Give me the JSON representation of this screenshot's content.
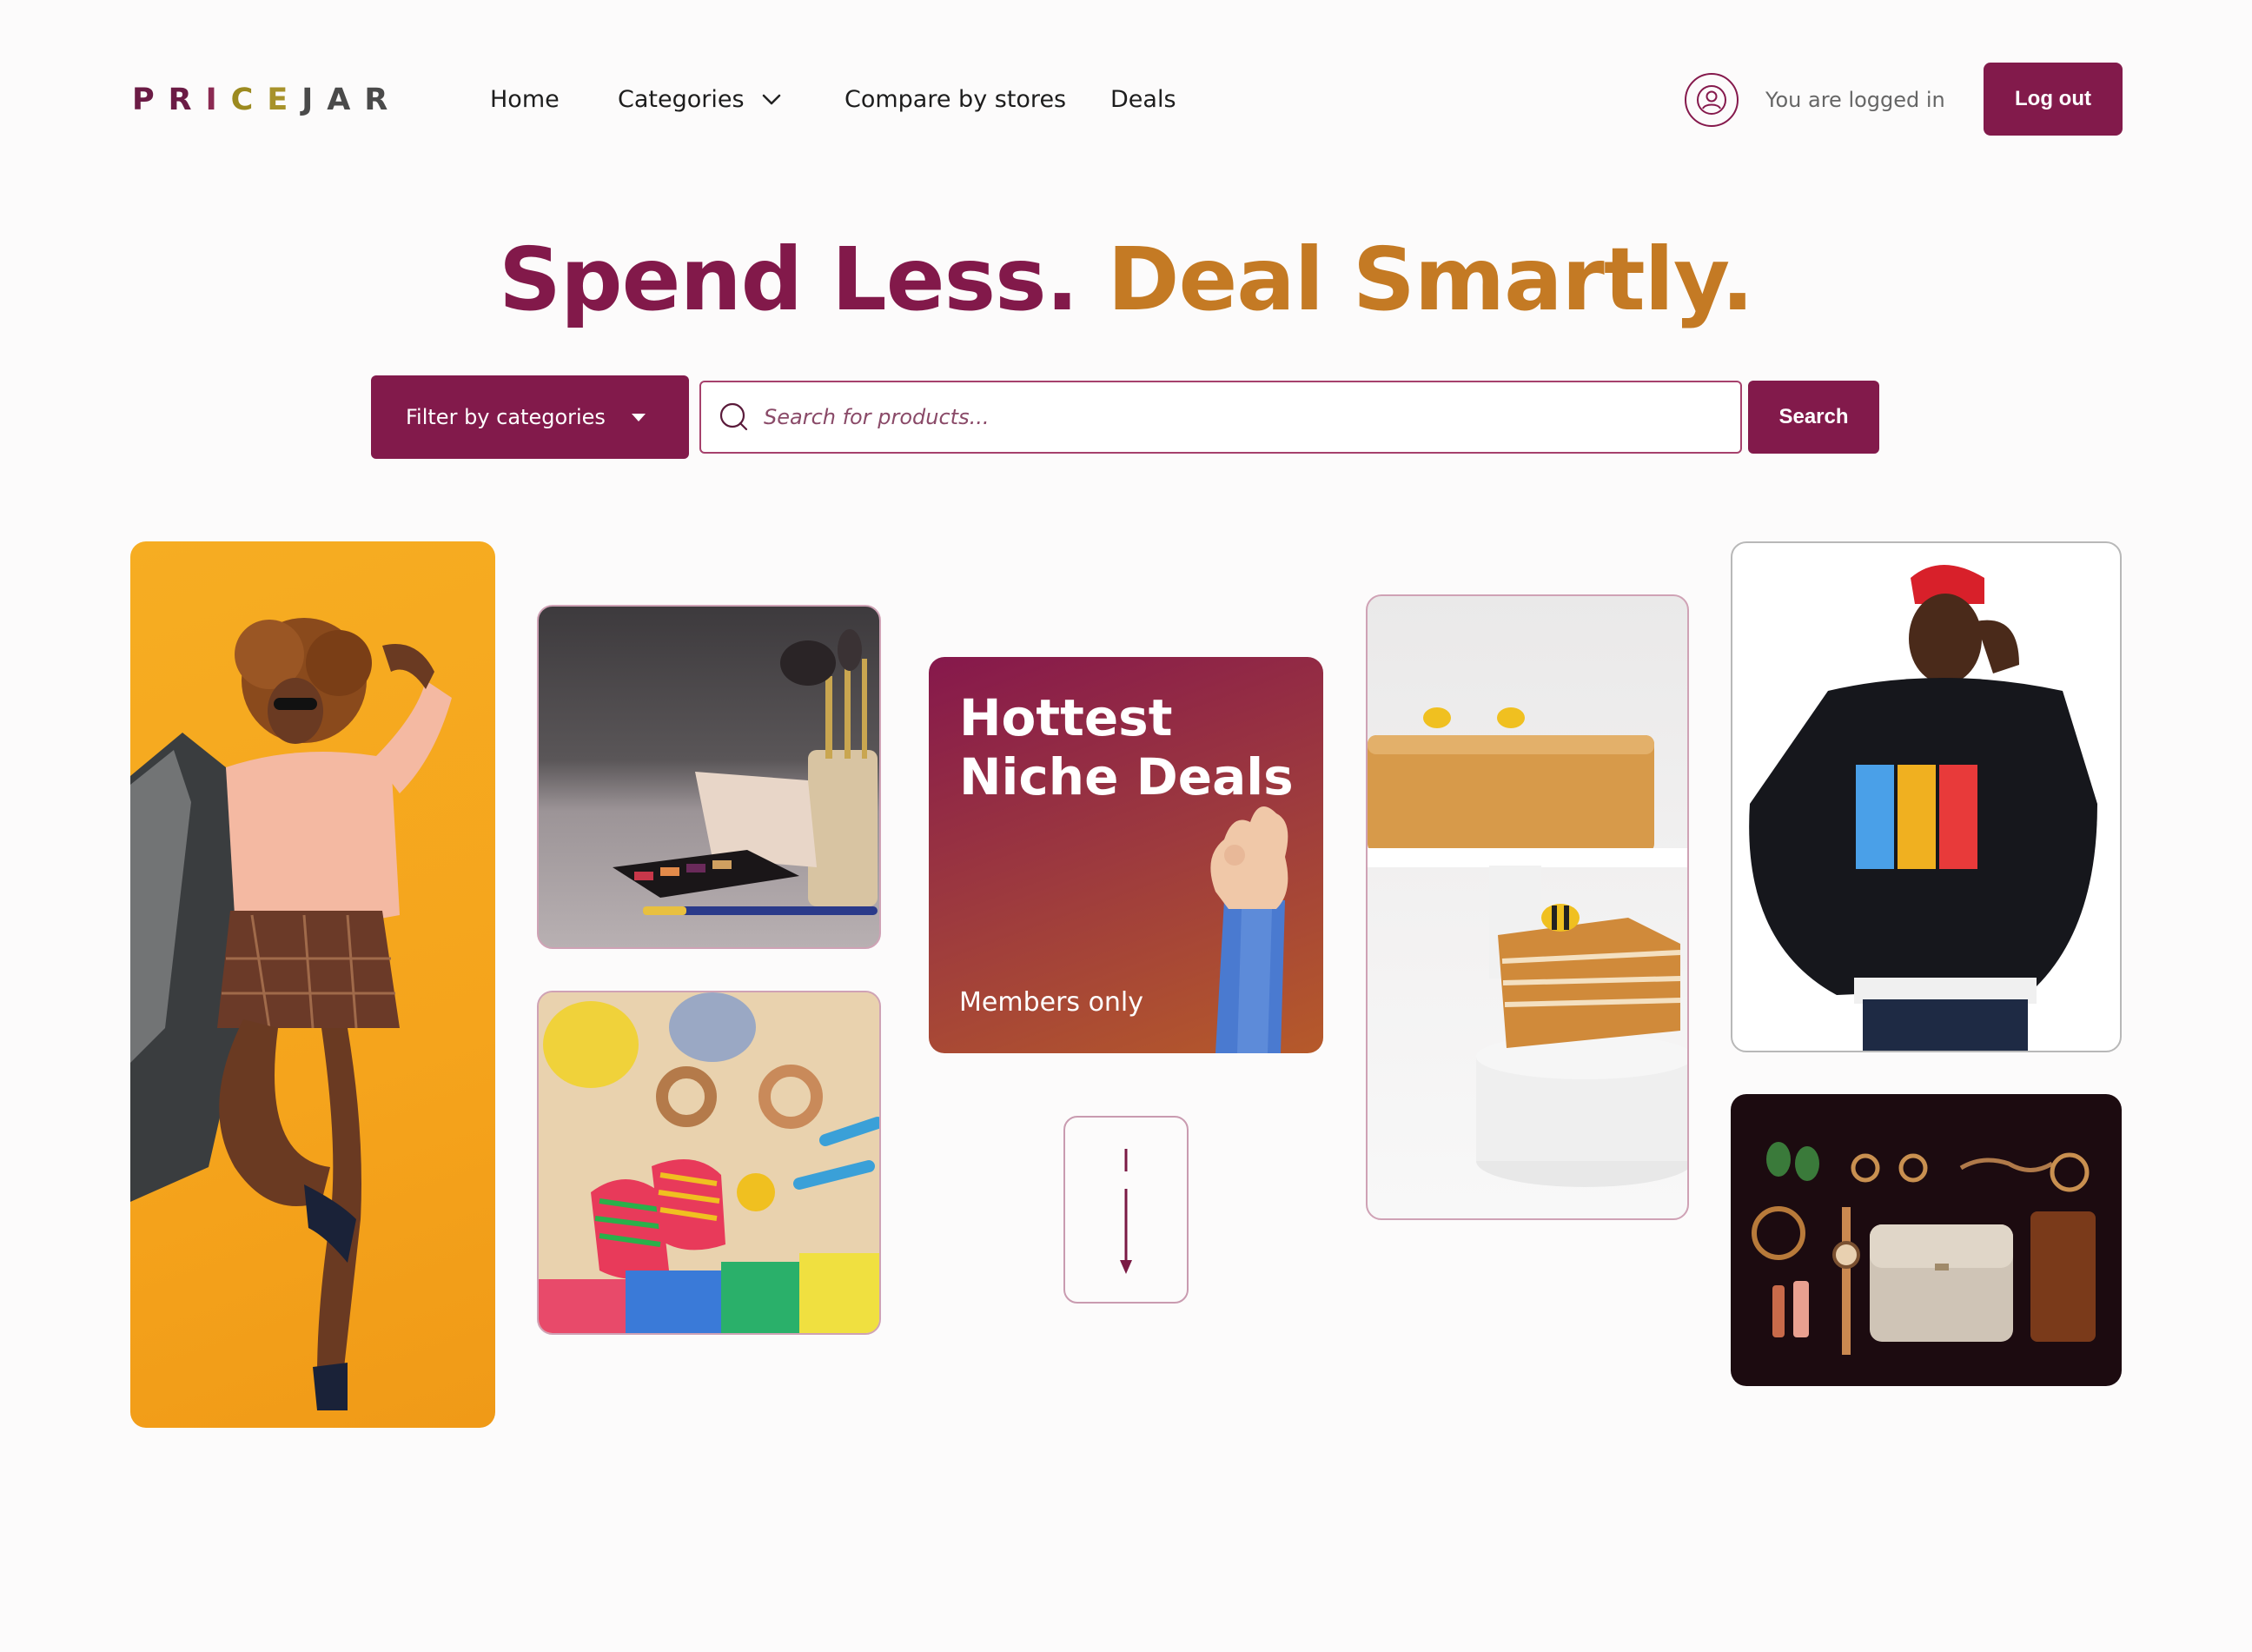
{
  "brand": {
    "logo_letters": [
      "P",
      "R",
      "I",
      "C",
      "E",
      "J",
      "A",
      "R"
    ],
    "logo_colors": [
      "#6b1b45",
      "#6b1b45",
      "#8b2a52",
      "#9c8a1f",
      "#a7922a",
      "#4a4a4a",
      "#4a4a4a",
      "#4a4a4a"
    ]
  },
  "nav": {
    "home": "Home",
    "categories": "Categories",
    "compare": "Compare by stores",
    "deals": "Deals"
  },
  "account": {
    "status": "You are logged in",
    "logout": "Log out"
  },
  "hero": {
    "headline_part1": "Spend Less.",
    "headline_part2": "Deal Smartly."
  },
  "search": {
    "filter_label": "Filter by categories",
    "placeholder": "Search for products...",
    "button": "Search"
  },
  "promo": {
    "title": "Hottest Niche Deals",
    "subtitle": "Members only"
  },
  "colors": {
    "primary": "#821a4b",
    "accent": "#c47a24",
    "background": "#fcfbfb"
  },
  "icons": {
    "user": "user-circle-icon",
    "search": "search-icon",
    "chevron": "chevron-down-icon",
    "scroll": "arrow-down-icon"
  }
}
